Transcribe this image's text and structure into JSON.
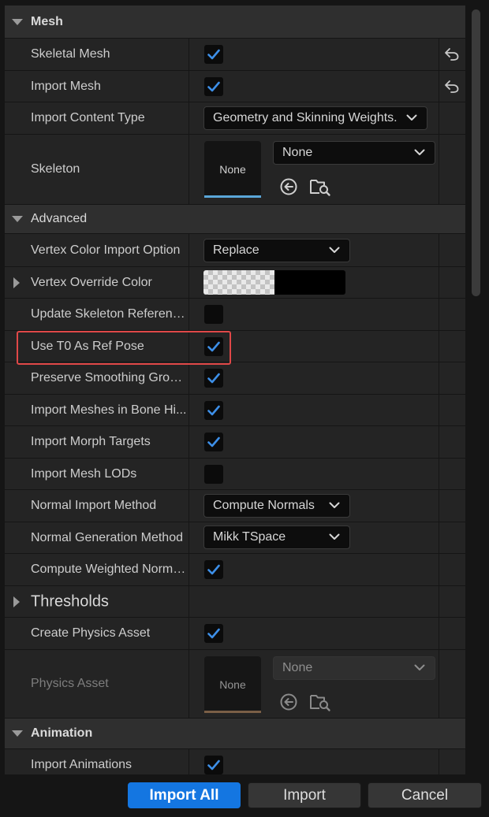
{
  "sections": {
    "mesh": "Mesh",
    "advanced": "Advanced",
    "animation": "Animation"
  },
  "rows": {
    "skeletal_mesh": {
      "label": "Skeletal Mesh",
      "checked": true
    },
    "import_mesh": {
      "label": "Import Mesh",
      "checked": true
    },
    "import_content_type": {
      "label": "Import Content Type",
      "value": "Geometry and Skinning Weights."
    },
    "skeleton": {
      "label": "Skeleton",
      "thumb": "None",
      "value": "None"
    },
    "vertex_color_import_option": {
      "label": "Vertex Color Import Option",
      "value": "Replace"
    },
    "vertex_override_color": {
      "label": "Vertex Override Color"
    },
    "update_skeleton_reference": {
      "label": "Update Skeleton Referenc...",
      "checked": false
    },
    "use_t0_as_ref_pose": {
      "label": "Use T0 As Ref Pose",
      "checked": true
    },
    "preserve_smoothing_groups": {
      "label": "Preserve Smoothing Groups",
      "checked": true
    },
    "import_meshes_in_bone_hierarchy": {
      "label": "Import Meshes in Bone Hi...",
      "checked": true
    },
    "import_morph_targets": {
      "label": "Import Morph Targets",
      "checked": true
    },
    "import_mesh_lods": {
      "label": "Import Mesh LODs",
      "checked": false
    },
    "normal_import_method": {
      "label": "Normal Import Method",
      "value": "Compute Normals"
    },
    "normal_generation_method": {
      "label": "Normal Generation Method",
      "value": "Mikk TSpace"
    },
    "compute_weighted_normals": {
      "label": "Compute Weighted Normals",
      "checked": true
    },
    "thresholds": {
      "label": "Thresholds"
    },
    "create_physics_asset": {
      "label": "Create Physics Asset",
      "checked": true
    },
    "physics_asset": {
      "label": "Physics Asset",
      "thumb": "None",
      "value": "None"
    },
    "import_animations": {
      "label": "Import Animations",
      "checked": true
    }
  },
  "buttons": {
    "import_all": "Import All",
    "import": "Import",
    "cancel": "Cancel"
  },
  "icons": {
    "checkmark": "check-icon",
    "reset": "reset-to-default-icon",
    "use_selected": "use-selected-arrow-icon",
    "browse": "browse-folder-icon"
  },
  "colors": {
    "accent": "#1476e1",
    "checkmark": "#3d8fe8",
    "highlight": "#e04848",
    "skeleton_thumb_bar": "#5aa6d8",
    "physics_thumb_bar": "#8a6a4c"
  }
}
